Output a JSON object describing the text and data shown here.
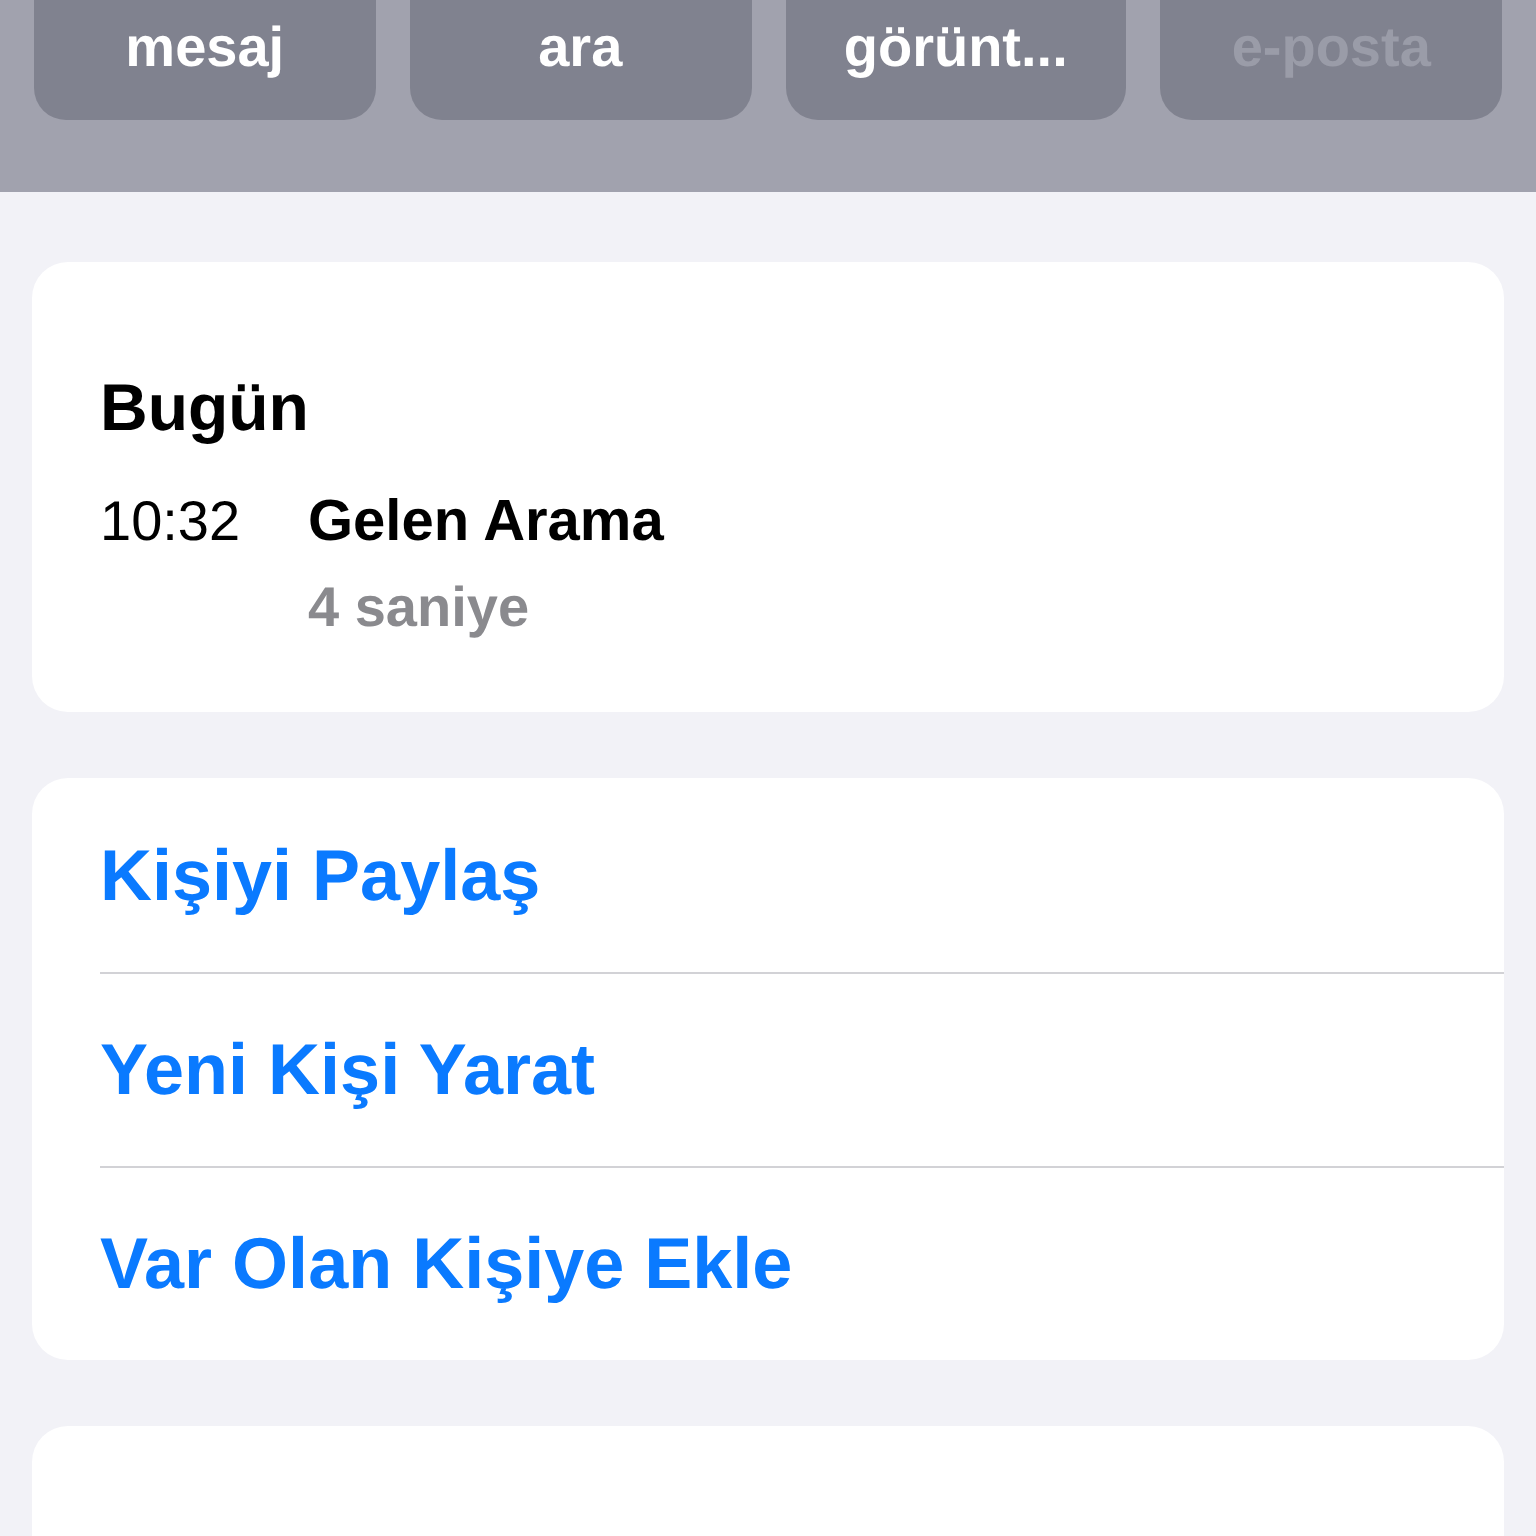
{
  "actions": [
    {
      "label": "mesaj",
      "disabled": false
    },
    {
      "label": "ara",
      "disabled": false
    },
    {
      "label": "görünt...",
      "disabled": false
    },
    {
      "label": "e-posta",
      "disabled": true
    }
  ],
  "history": {
    "heading": "Bugün",
    "entries": [
      {
        "time": "10:32",
        "title": "Gelen Arama",
        "detail": "4 saniye"
      }
    ]
  },
  "options": [
    {
      "label": "Kişiyi Paylaş"
    },
    {
      "label": "Yeni Kişi Yarat"
    },
    {
      "label": "Var Olan Kişiye Ekle"
    }
  ]
}
